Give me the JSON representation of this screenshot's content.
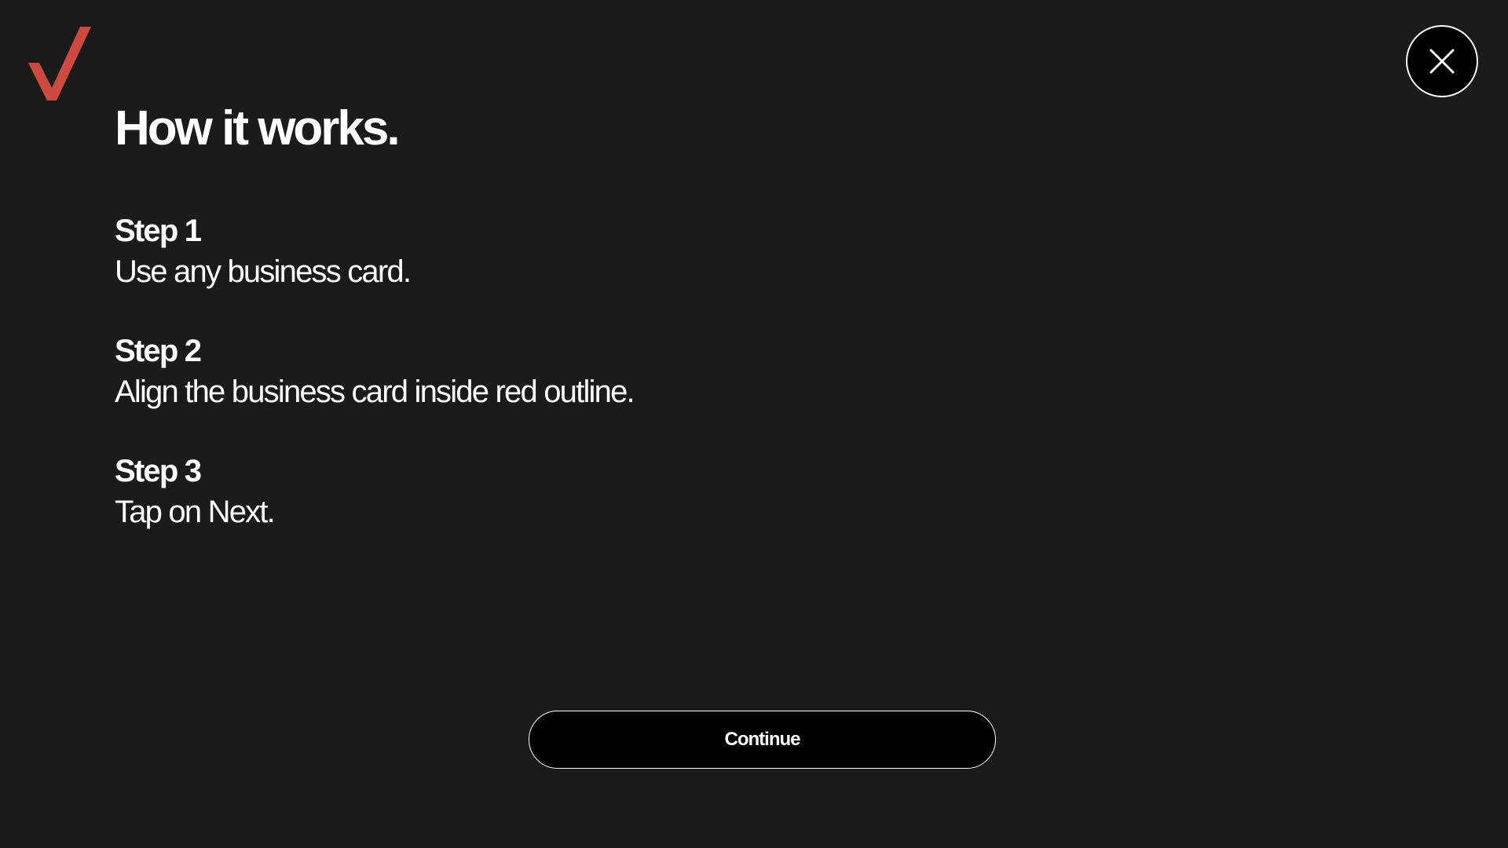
{
  "header": {
    "logo_icon": "verizon-checkmark-icon",
    "logo_color": "#cd4a40",
    "close_icon": "close-icon"
  },
  "main": {
    "title": "How it works.",
    "steps": [
      {
        "heading": "Step 1",
        "text": "Use any business card."
      },
      {
        "heading": "Step 2",
        "text": "Align the business card inside red outline."
      },
      {
        "heading": "Step 3",
        "text": "Tap on Next."
      }
    ]
  },
  "footer": {
    "continue_label": "Continue"
  },
  "colors": {
    "background": "#1b1b1b",
    "button_background": "#000000",
    "text": "#ffffff",
    "accent": "#cd4a40"
  }
}
